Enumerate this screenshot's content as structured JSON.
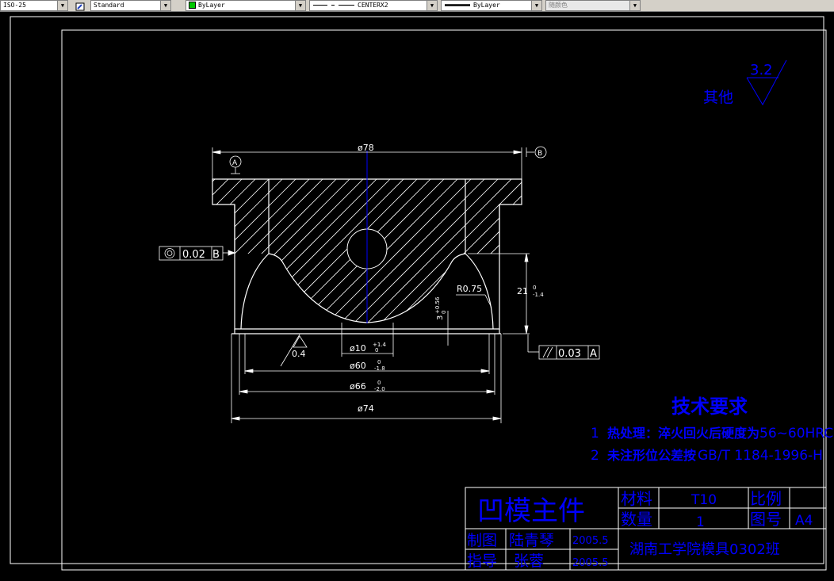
{
  "toolbar": {
    "dimstyle_value": "ISO-25",
    "textstyle_value": "Standard",
    "layer_value": "ByLayer",
    "layer_color": "#00c800",
    "linetype_value": "CENTERX2",
    "lineweight_value": "ByLayer",
    "plotstyle_value": "随颜色"
  },
  "drawing": {
    "dims": {
      "d78": "ø78",
      "datum_a": "A",
      "datum_b": "B",
      "coax_tol": "0.02",
      "coax_ref": "B",
      "r075": "R0.75",
      "d21": "21",
      "d21_tol_upper": "0",
      "d21_tol_lower": "-1.4",
      "d3": "3",
      "d3_tol_upper": "+0.56",
      "d3_tol_lower": "0",
      "rough_bore": "0.4",
      "d10": "ø10",
      "d10_tol_upper": "+1.4",
      "d10_tol_lower": "0",
      "d60": "ø60",
      "d60_tol_upper": "0",
      "d60_tol_lower": "-1.8",
      "d66": "ø66",
      "d66_tol_upper": "0",
      "d66_tol_lower": "-2.0",
      "d74": "ø74",
      "parallel_tol": "0.03",
      "parallel_ref": "A"
    },
    "roughness": {
      "value": "3.2",
      "label": "其他"
    },
    "tech": {
      "title": "技术要求",
      "line1_num": "1",
      "line1_bold": "热处理：淬火回火后硬度为",
      "line1_rest": "56~60HRC",
      "line2_num": "2",
      "line2_bold": "未注形位公差按",
      "line2_rest": "GB/T 1184-1996-H"
    },
    "title_block": {
      "part_name": "凹模主件",
      "material_label": "材料",
      "material_value": "T10",
      "scale_label": "比例",
      "scale_value": "",
      "qty_label": "数量",
      "qty_value": "1",
      "drawing_no_label": "图号",
      "drawing_no_value": "A4",
      "drawn_label": "制图",
      "drawn_name": "陆青琴",
      "drawn_date": "2005.5",
      "checked_label": "指导",
      "checked_name": "张蓉",
      "checked_date": "2005.5",
      "school": "湖南工学院模具0302班"
    }
  },
  "colors": {
    "geometry": "#ffffff",
    "center_line": "#0000ff",
    "annotation": "#0000ff",
    "background": "#000000",
    "toolbar": "#d4d0c8"
  }
}
